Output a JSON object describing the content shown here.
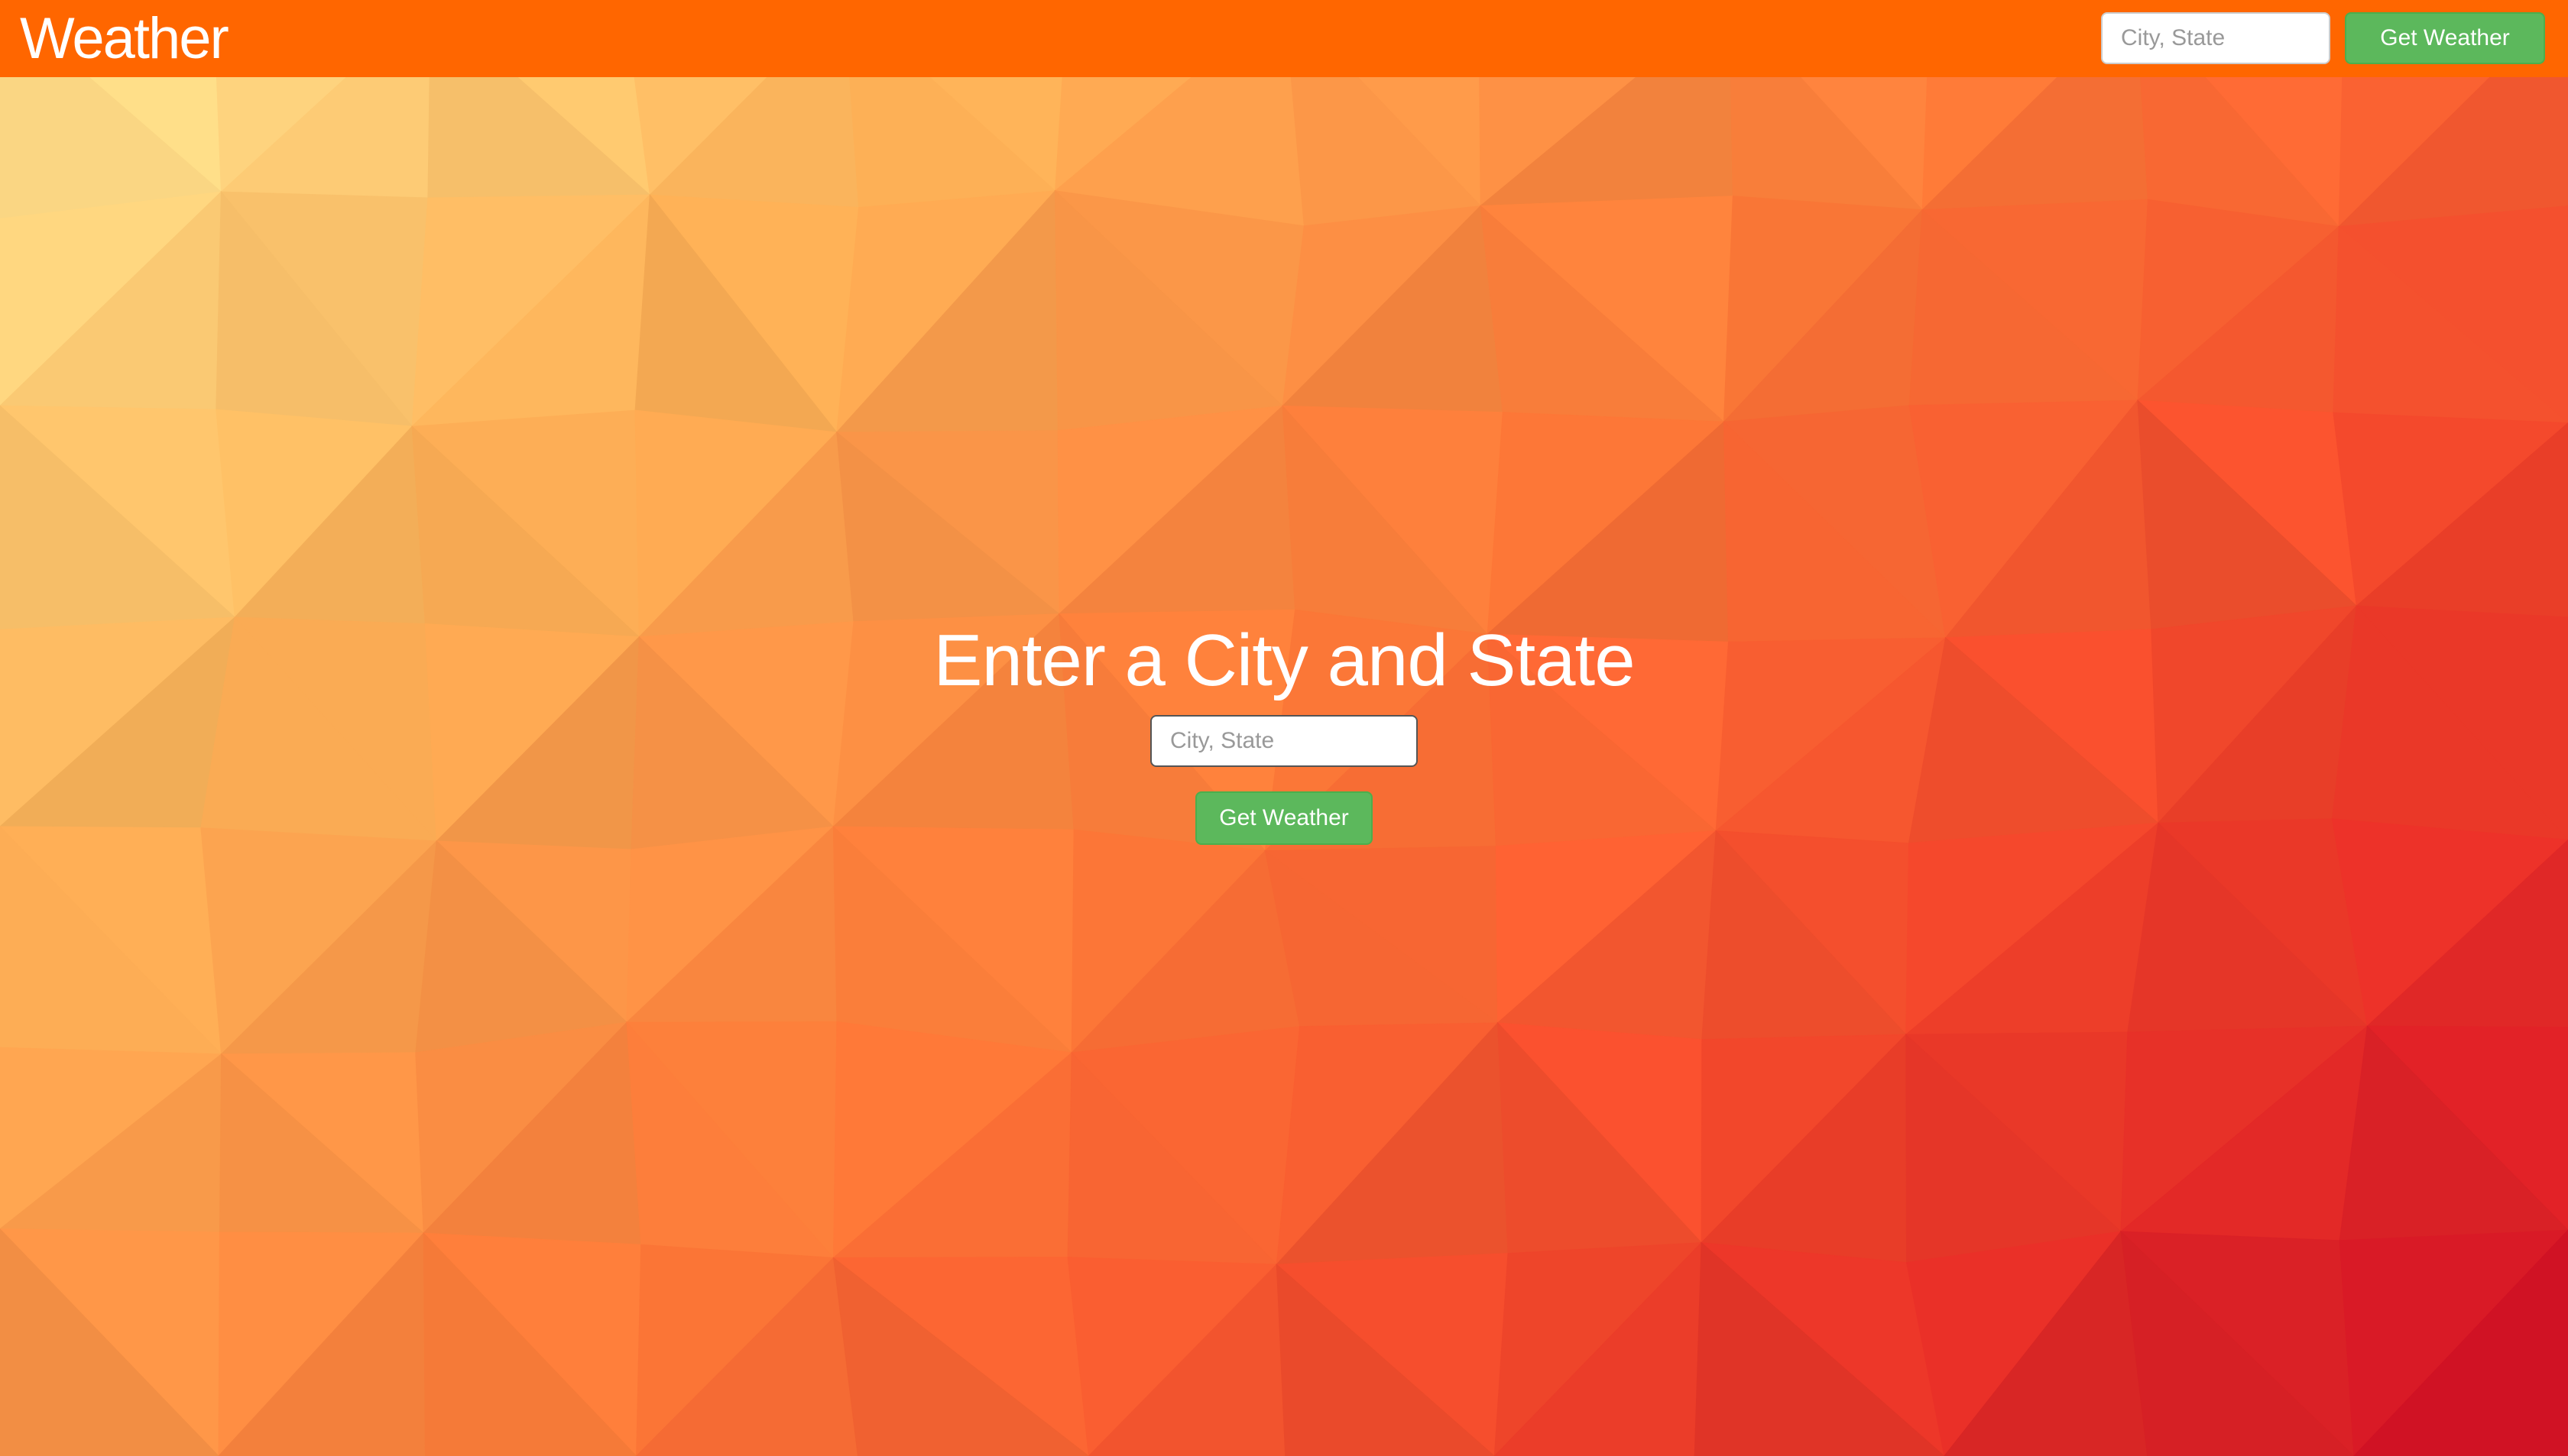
{
  "header": {
    "brand": "Weather",
    "search_placeholder": "City, State",
    "submit_label": "Get Weather"
  },
  "hero": {
    "title": "Enter a City and State",
    "search_placeholder": "City, State",
    "submit_label": "Get Weather"
  },
  "colors": {
    "navbar": "#ff6600",
    "button": "#5cb85c",
    "background_gradient": [
      "#ffe592",
      "#ffb358",
      "#ff7a38",
      "#f3402a",
      "#cf0a24"
    ]
  }
}
